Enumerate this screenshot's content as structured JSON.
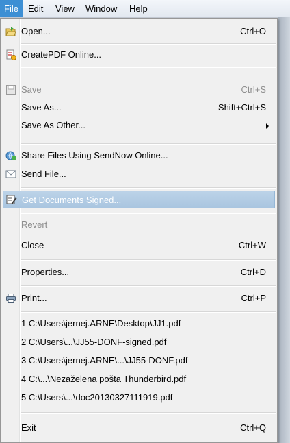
{
  "menubar": {
    "items": [
      {
        "label": "File"
      },
      {
        "label": "Edit"
      },
      {
        "label": "View"
      },
      {
        "label": "Window"
      },
      {
        "label": "Help"
      }
    ]
  },
  "menu": {
    "items": [
      {
        "id": "open",
        "label": "Open...",
        "shortcut": "Ctrl+O",
        "icon": "open-folder-icon"
      },
      {
        "id": "createpdf",
        "label": "CreatePDF Online...",
        "shortcut": "",
        "icon": "createpdf-icon"
      },
      {
        "id": "save",
        "label": "Save",
        "shortcut": "Ctrl+S",
        "icon": "save-icon",
        "disabled": true
      },
      {
        "id": "saveas",
        "label": "Save As...",
        "shortcut": "Shift+Ctrl+S"
      },
      {
        "id": "saveasother",
        "label": "Save As Other...",
        "submenu": true
      },
      {
        "id": "share",
        "label": "Share Files Using SendNow Online...",
        "icon": "share-files-icon"
      },
      {
        "id": "sendfile",
        "label": "Send File...",
        "icon": "envelope-icon"
      },
      {
        "id": "getsigned",
        "label": "Get Documents Signed...",
        "icon": "sign-icon",
        "highlighted": true
      },
      {
        "id": "revert",
        "label": "Revert",
        "disabled": true
      },
      {
        "id": "close",
        "label": "Close",
        "shortcut": "Ctrl+W"
      },
      {
        "id": "properties",
        "label": "Properties...",
        "shortcut": "Ctrl+D"
      },
      {
        "id": "print",
        "label": "Print...",
        "shortcut": "Ctrl+P",
        "icon": "printer-icon"
      },
      {
        "id": "recent1",
        "label": "1 C:\\Users\\jernej.ARNE\\Desktop\\JJ1.pdf"
      },
      {
        "id": "recent2",
        "label": "2 C:\\Users\\...\\JJ55-DONF-signed.pdf"
      },
      {
        "id": "recent3",
        "label": "3 C:\\Users\\jernej.ARNE\\...\\JJ55-DONF.pdf"
      },
      {
        "id": "recent4",
        "label": "4 C:\\...\\Nezaželena pošta Thunderbird.pdf"
      },
      {
        "id": "recent5",
        "label": "5 C:\\Users\\...\\doc20130327111919.pdf"
      },
      {
        "id": "exit",
        "label": "Exit",
        "shortcut": "Ctrl+Q"
      }
    ]
  },
  "colors": {
    "menubar_active": "#3d8fd4",
    "highlight": "#a9c5e0",
    "menu_bg": "#f0f0f0",
    "disabled_text": "#8d8d8d"
  }
}
